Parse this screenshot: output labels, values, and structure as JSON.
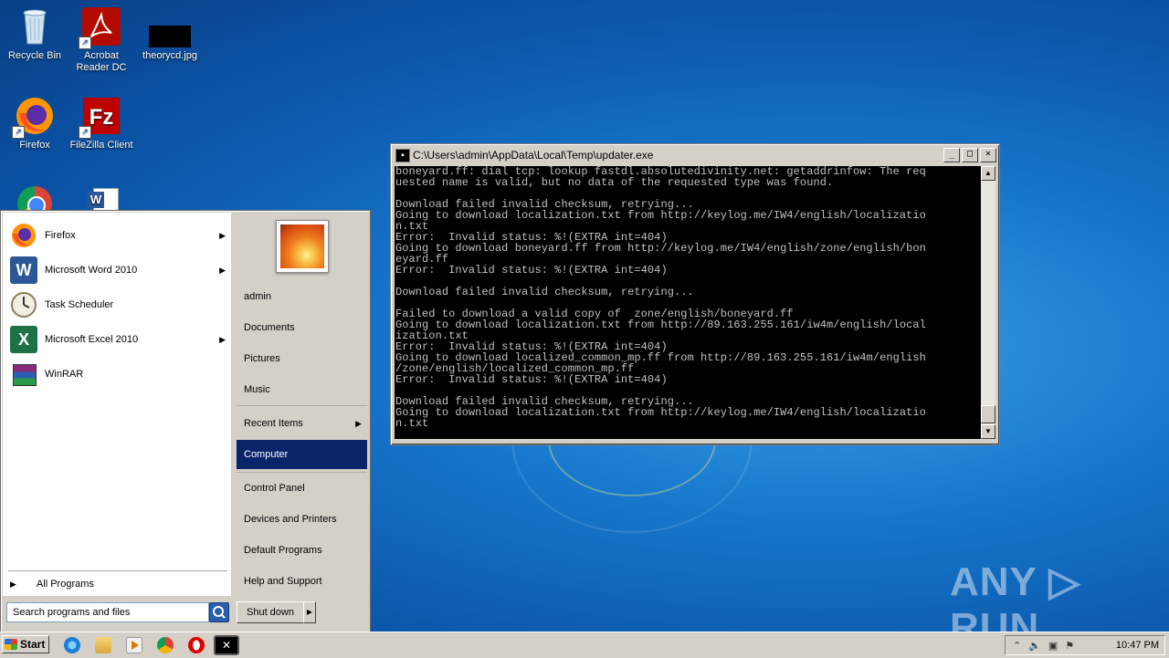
{
  "desktop": {
    "icons": [
      {
        "label": "Recycle Bin",
        "icon": "recycle-bin-icon"
      },
      {
        "label": "Acrobat\nReader DC",
        "icon": "acrobat-icon"
      },
      {
        "label": "theorycd.jpg",
        "icon": "image-file-icon"
      },
      {
        "label": "Firefox",
        "icon": "firefox-icon"
      },
      {
        "label": "FileZilla Client",
        "icon": "filezilla-icon"
      }
    ]
  },
  "console": {
    "title": "C:\\Users\\admin\\AppData\\Local\\Temp\\updater.exe",
    "output": "boneyard.ff: dial tcp: lookup fastdl.absolutedivinity.net: getaddrinfow: The req\nuested name is valid, but no data of the requested type was found.\n\nDownload failed invalid checksum, retrying...\nGoing to download localization.txt from http://keylog.me/IW4/english/localizatio\nn.txt\nError:  Invalid status: %!(EXTRA int=404)\nGoing to download boneyard.ff from http://keylog.me/IW4/english/zone/english/bon\neyard.ff\nError:  Invalid status: %!(EXTRA int=404)\n\nDownload failed invalid checksum, retrying...\n\nFailed to download a valid copy of  zone/english/boneyard.ff\nGoing to download localization.txt from http://89.163.255.161/iw4m/english/local\nization.txt\nError:  Invalid status: %!(EXTRA int=404)\nGoing to download localized_common_mp.ff from http://89.163.255.161/iw4m/english\n/zone/english/localized_common_mp.ff\nError:  Invalid status: %!(EXTRA int=404)\n\nDownload failed invalid checksum, retrying...\nGoing to download localization.txt from http://keylog.me/IW4/english/localizatio\nn.txt"
  },
  "start_menu": {
    "programs": [
      {
        "label": "Firefox",
        "icon": "firefox-icon",
        "submenu": true
      },
      {
        "label": "Microsoft Word 2010",
        "icon": "word-icon",
        "submenu": true
      },
      {
        "label": "Task Scheduler",
        "icon": "task-scheduler-icon",
        "submenu": false
      },
      {
        "label": "Microsoft Excel 2010",
        "icon": "excel-icon",
        "submenu": true
      },
      {
        "label": "WinRAR",
        "icon": "winrar-icon",
        "submenu": false
      }
    ],
    "all_programs": "All Programs",
    "search_placeholder": "Search programs and files",
    "right_items": {
      "user": "admin",
      "documents": "Documents",
      "pictures": "Pictures",
      "music": "Music",
      "recent_items": "Recent Items",
      "computer": "Computer",
      "control_panel": "Control Panel",
      "devices_printers": "Devices and Printers",
      "default_programs": "Default Programs",
      "help_support": "Help and Support"
    },
    "shutdown": "Shut down"
  },
  "taskbar": {
    "start_label": "Start",
    "pinned": [
      "ie-icon",
      "explorer-icon",
      "media-player-icon",
      "chrome-icon",
      "opera-icon",
      "console-icon"
    ],
    "clock": "10:47 PM"
  },
  "watermark": "ANY ▷ RUN",
  "colors": {
    "desktop_blue": "#1677cc",
    "selection": "#0a246a",
    "console_bg": "#000000",
    "console_fg": "#c0c0c0"
  }
}
